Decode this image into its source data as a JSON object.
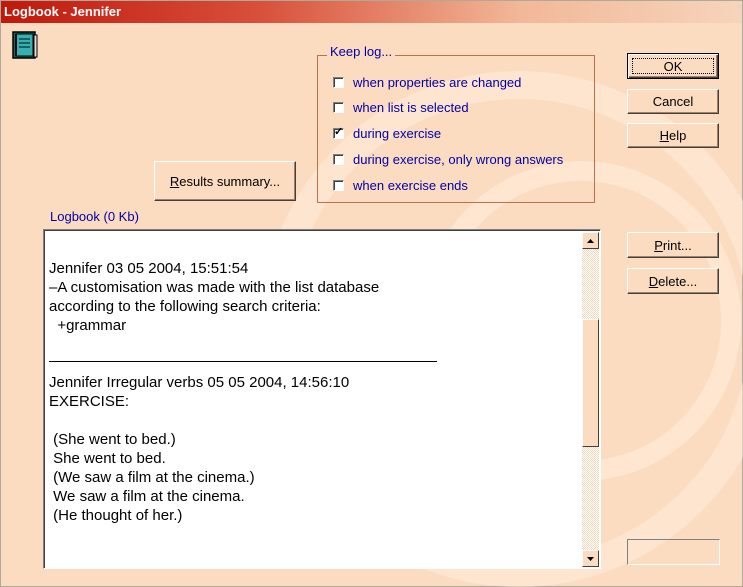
{
  "window": {
    "title": "Logbook - Jennifer",
    "icon": "logbook-book-icon",
    "accent": "#c0180c",
    "background": "#fcdcc0"
  },
  "keep_log": {
    "label": "Keep log...",
    "options": [
      {
        "label": "when properties are changed",
        "checked": false
      },
      {
        "label": "when list is selected",
        "checked": false
      },
      {
        "label": "during exercise",
        "checked": true
      },
      {
        "label": "during exercise, only wrong answers",
        "checked": false
      },
      {
        "label": "when exercise ends",
        "checked": false
      }
    ]
  },
  "buttons": {
    "ok": "OK",
    "cancel": "Cancel",
    "help_mnemonic": "H",
    "help_rest": "elp",
    "results_mnemonic": "R",
    "results_rest": "esults summary...",
    "print_mnemonic": "P",
    "print_rest": "rint...",
    "delete_mnemonic": "D",
    "delete_rest": "elete..."
  },
  "logbook": {
    "label": "Logbook (0 Kb)",
    "lines": [
      "Jennifer 03 05 2004, 15:51:54",
      "–A customisation was made with the list database",
      "according to the following search criteria:",
      "  +grammar",
      "",
      "",
      "Jennifer Irregular verbs 05 05 2004, 14:56:10",
      "EXERCISE:",
      "",
      " (She went to bed.)",
      " She went to bed.",
      " (We saw a film at the cinema.)",
      " We saw a film at the cinema.",
      " (He thought of her.)"
    ]
  }
}
